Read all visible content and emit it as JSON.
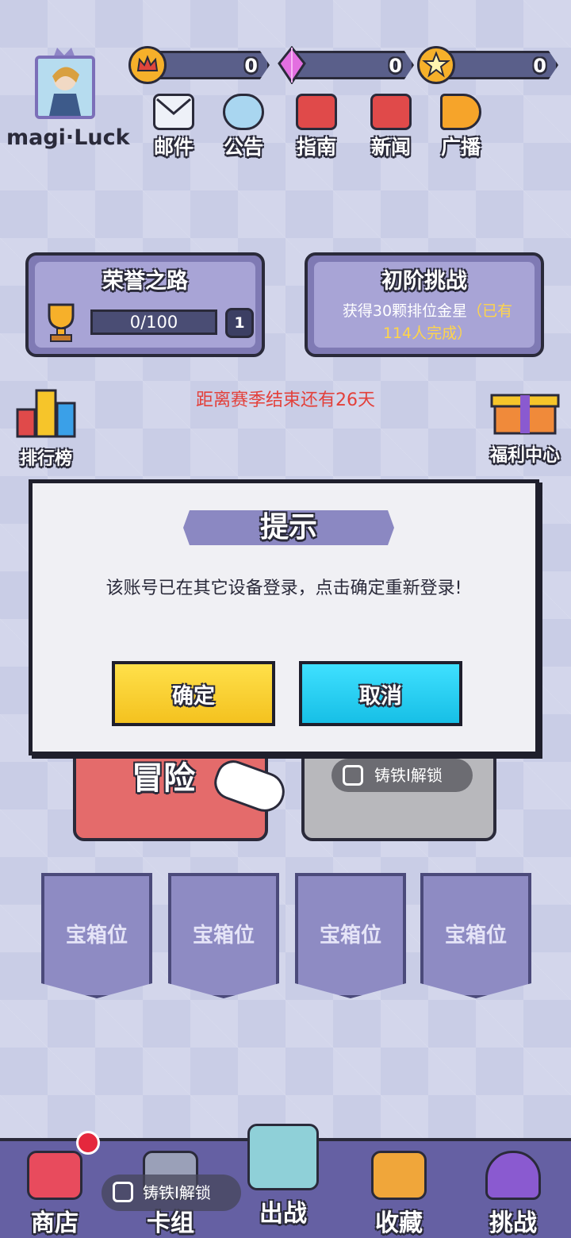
{
  "player": {
    "name": "magi·Luck"
  },
  "resources": [
    {
      "name": "crown",
      "value": "0",
      "color": "#f6b02a"
    },
    {
      "name": "crystal",
      "value": "0",
      "color": "#e36fe0"
    },
    {
      "name": "star-medal",
      "value": "0",
      "color": "#f6b02a"
    }
  ],
  "top_menu": [
    {
      "icon": "mail-icon",
      "label": "邮件",
      "color": "#eef1f8"
    },
    {
      "icon": "announcement-icon",
      "label": "公告",
      "color": "#a9d6f0"
    },
    {
      "icon": "guide-book-icon",
      "label": "指南",
      "color": "#e04a4a"
    },
    {
      "icon": "news-tv-icon",
      "label": "新闻",
      "color": "#e04a4a"
    },
    {
      "icon": "megaphone-icon",
      "label": "广播",
      "color": "#f6a42a"
    }
  ],
  "honor_panel": {
    "title": "荣誉之路",
    "progress_text": "0/100",
    "progress": 0.0,
    "level": "1"
  },
  "challenge_panel": {
    "title": "初阶挑战",
    "desc_main": "获得30颗排位金星",
    "desc_highlight": "（已有114人完成）"
  },
  "season": {
    "text": "距离赛季结束还有26天"
  },
  "side_left": {
    "label": "排行榜"
  },
  "side_right": {
    "label": "福利中心"
  },
  "modes": {
    "adventure_label": "冒险",
    "locked_label": "铸铁I解锁"
  },
  "chest_slots": [
    "宝箱位",
    "宝箱位",
    "宝箱位",
    "宝箱位"
  ],
  "bottom_nav": [
    {
      "icon": "shop-icon",
      "label": "商店",
      "color": "#e84b5d"
    },
    {
      "icon": "card-deck-icon",
      "label": "卡组",
      "color": "#9aa0b8",
      "lock_text": "铸铁I解锁"
    },
    {
      "icon": "crossed-swords-icon",
      "label": "出战",
      "color": "#8fd0d8"
    },
    {
      "icon": "treasure-chest-icon",
      "label": "收藏",
      "color": "#f0a63a"
    },
    {
      "icon": "helmet-icon",
      "label": "挑战",
      "color": "#8a5ad0"
    }
  ],
  "modal": {
    "title": "提示",
    "message": "该账号已在其它设备登录，点击确定重新登录!",
    "confirm_label": "确定",
    "cancel_label": "取消"
  }
}
